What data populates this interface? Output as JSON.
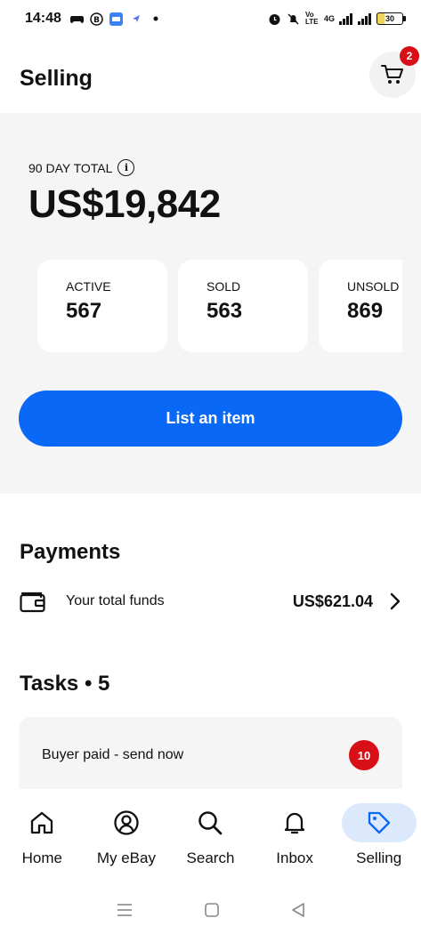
{
  "status_bar": {
    "time": "14:48",
    "battery": "30",
    "network": "4G",
    "volte": "Vo LTE"
  },
  "header": {
    "title": "Selling",
    "cart_badge": "2"
  },
  "summary": {
    "total_label": "90 DAY TOTAL",
    "total_value": "US$19,842",
    "stats": [
      {
        "label": "ACTIVE",
        "value": "567"
      },
      {
        "label": "SOLD",
        "value": "563"
      },
      {
        "label": "UNSOLD",
        "value": "869"
      }
    ],
    "list_button": "List an item"
  },
  "payments": {
    "title": "Payments",
    "funds_label": "Your total funds",
    "funds_value": "US$621.04"
  },
  "tasks": {
    "title": "Tasks • 5",
    "items": [
      {
        "label": "Buyer paid - send now",
        "count": "10"
      }
    ]
  },
  "bottom_nav": {
    "items": [
      {
        "label": "Home",
        "icon": "home-icon"
      },
      {
        "label": "My eBay",
        "icon": "profile-icon"
      },
      {
        "label": "Search",
        "icon": "search-icon"
      },
      {
        "label": "Inbox",
        "icon": "bell-icon"
      },
      {
        "label": "Selling",
        "icon": "tag-icon",
        "active": true
      }
    ]
  },
  "colors": {
    "accent": "#0968f6",
    "badge": "#d80f16",
    "panel": "#f5f5f5",
    "active_nav_bg": "#dce9fc",
    "tag_icon": "#0968f6"
  }
}
